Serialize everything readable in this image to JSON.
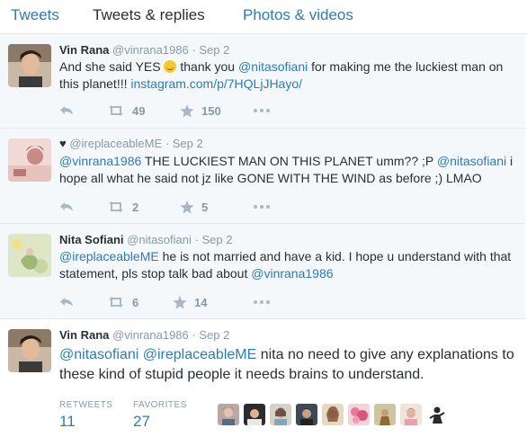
{
  "tabs": [
    "Tweets",
    "Tweets & replies",
    "Photos & videos"
  ],
  "tweets": [
    {
      "name": "Vin Rana",
      "handle": "@vinrana1986",
      "date": "Sep 2",
      "parts": [
        "And she said YES ",
        " thank you ",
        "@nitasofiani",
        " for making me the luckiest man on this planet!!! ",
        "instagram.com/p/7HQLjJHayo/"
      ],
      "retweets": "49",
      "favorites": "150"
    },
    {
      "name": "",
      "prefix": "♥",
      "handle": "@ireplaceableME",
      "date": "Sep 2",
      "parts": [
        "@vinrana1986",
        " THE LUCKIEST MAN ON THIS PLANET umm?? ;P ",
        "@nitasofiani",
        " i hope all what he said not jz like GONE WITH THE WIND as before ;) LMAO"
      ],
      "retweets": "2",
      "favorites": "5"
    },
    {
      "name": "Nita Sofiani",
      "handle": "@nitasofiani",
      "date": "Sep 2",
      "parts": [
        "@ireplaceableME",
        " he is not married and have a kid. I hope u understand with that statement, pls stop talk bad about ",
        "@vinrana1986"
      ],
      "retweets": "6",
      "favorites": "14"
    },
    {
      "name": "Vin Rana",
      "handle": "@vinrana1986",
      "date": "Sep 2",
      "parts": [
        "@nitasofiani",
        " ",
        "@ireplaceableME",
        " nita no need to give any explanations to these kind of stupid people it needs brains to understand."
      ],
      "stats": {
        "retweets_label": "RETWEETS",
        "retweets": "11",
        "favorites_label": "FAVORITES",
        "favorites": "27"
      }
    }
  ],
  "separator": "·",
  "colors": {
    "link": "#2b7bb9",
    "muted": "#8899a6",
    "text": "#292f33",
    "row_bg": "#f5f8fa"
  },
  "icons": [
    "reply-icon",
    "retweet-icon",
    "favorite-star-icon",
    "more-icon"
  ]
}
